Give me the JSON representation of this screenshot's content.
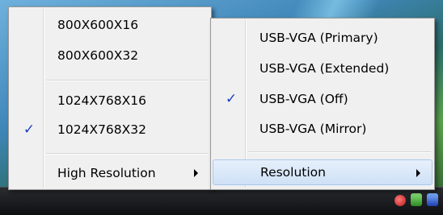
{
  "left_menu": {
    "items": [
      {
        "label": "800X600X16",
        "checked": false
      },
      {
        "label": "800X600X32",
        "checked": false
      },
      {
        "label": "1024X768X16",
        "checked": false
      },
      {
        "label": "1024X768X32",
        "checked": true,
        "check_glyph": "✓"
      },
      {
        "label": "High Resolution",
        "submenu": true
      }
    ]
  },
  "right_menu": {
    "items": [
      {
        "label": "USB-VGA (Primary)",
        "checked": false
      },
      {
        "label": "USB-VGA (Extended)",
        "checked": false
      },
      {
        "label": "USB-VGA (Off)",
        "checked": true,
        "check_glyph": "✓"
      },
      {
        "label": "USB-VGA (Mirror)",
        "checked": false
      },
      {
        "label": "Resolution",
        "submenu": true,
        "highlighted": true
      }
    ]
  },
  "tray_icons": [
    "red-shield-icon",
    "network-icon",
    "display-icon"
  ],
  "colors": {
    "menu_bg": "#f0f0f0",
    "check": "#1a3fbf",
    "highlight": "#cfe1f6",
    "taskbar": "#0e0f11"
  }
}
